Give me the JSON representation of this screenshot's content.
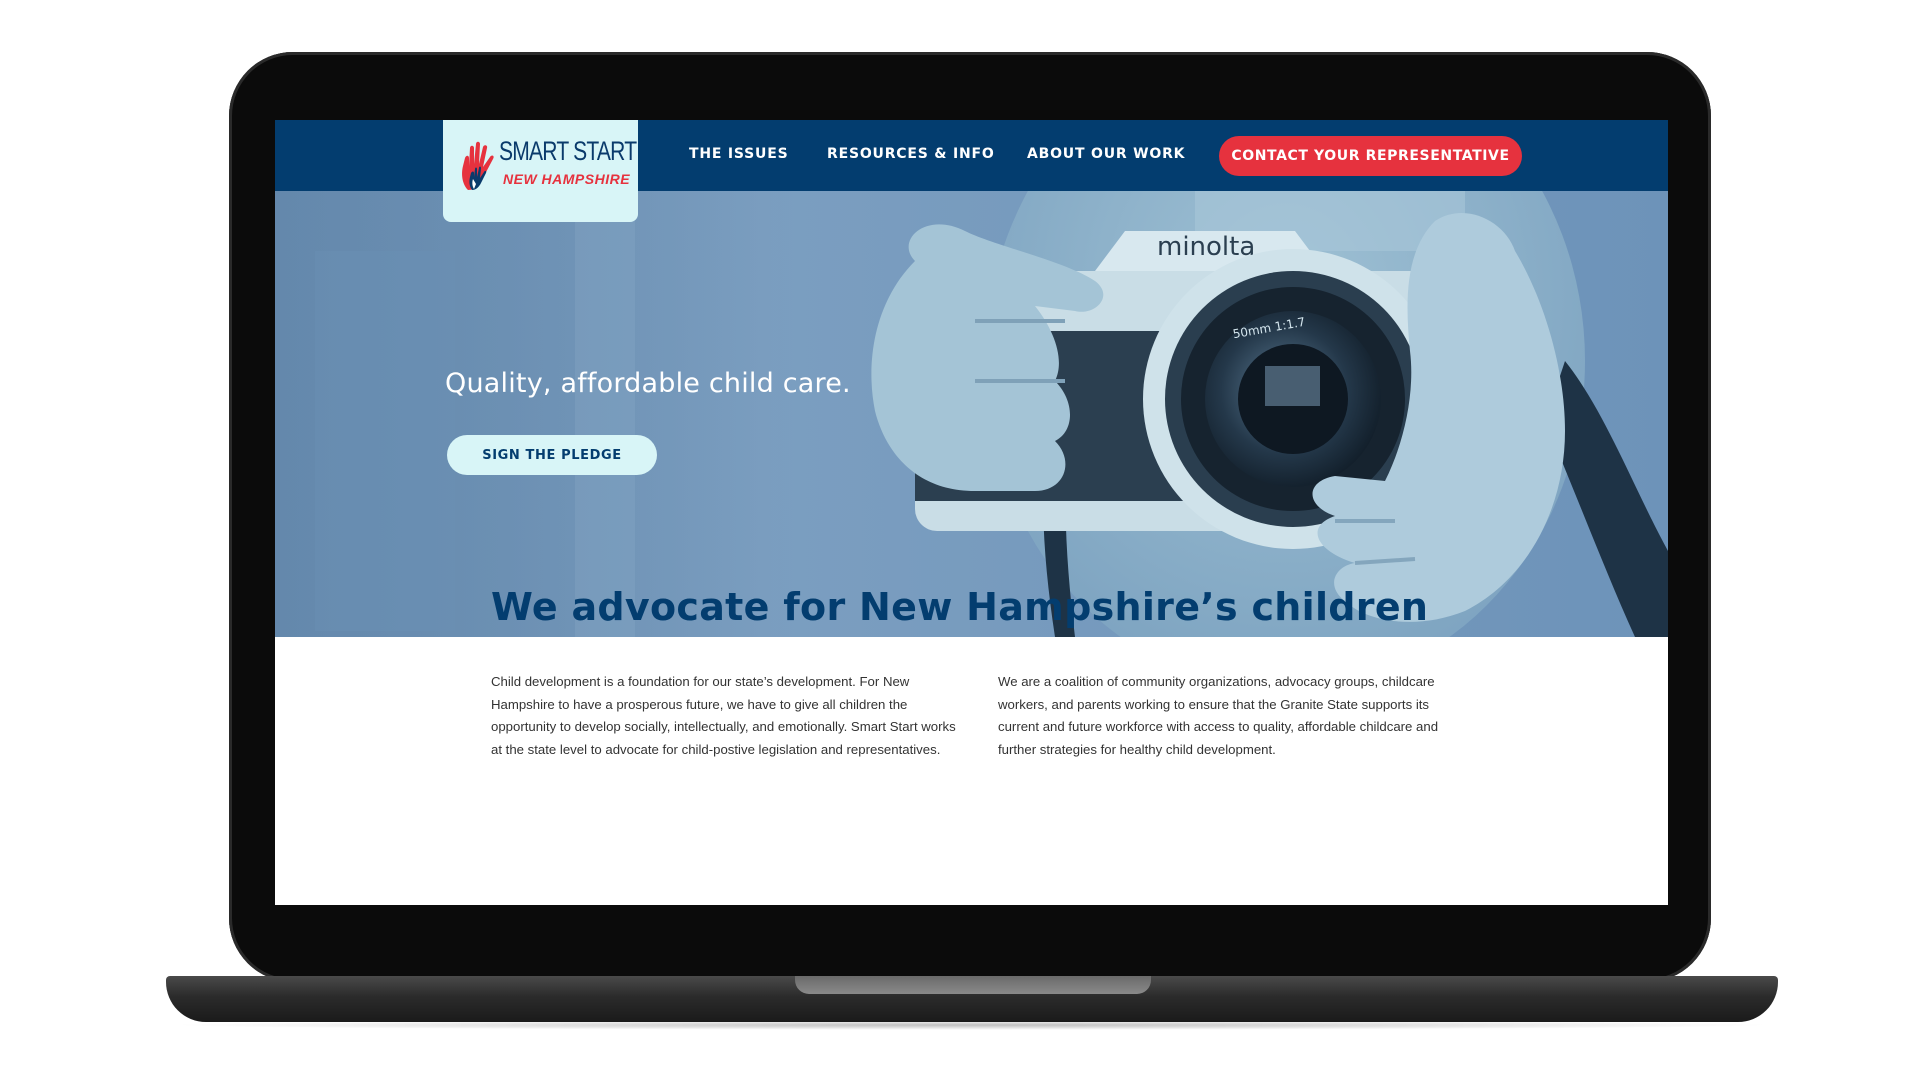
{
  "nav": {
    "logo_line1": "SMART START",
    "logo_line2": "NEW HAMPSHIRE",
    "links": [
      "THE ISSUES",
      "RESOURCES & INFO",
      "ABOUT OUR WORK"
    ],
    "cta": "CONTACT YOUR REPRESENTATIVE"
  },
  "hero": {
    "headline": "Quality, affordable child care.",
    "button": "SIGN THE PLEDGE",
    "camera_brand": "minolta",
    "lens_text": "50mm 1:1.7"
  },
  "content": {
    "title": "We advocate for New Hampshire’s children",
    "paragraph_left": "Child development is a foundation for our state’s development. For New Hampshire to have a prosperous future, we have to give all children the opportunity to develop socially, intellectually, and emotionally. Smart Start works at the state level to advocate for child-postive legislation and representatives.",
    "paragraph_right": "We are a coalition of community organizations, advocacy groups, childcare workers, and parents working to ensure that the Granite State supports its current and future workforce with access to quality, affordable childcare and further strategies for healthy child development."
  },
  "colors": {
    "navy": "#033d6f",
    "red": "#e6323e",
    "mint": "#d8f5f7"
  }
}
